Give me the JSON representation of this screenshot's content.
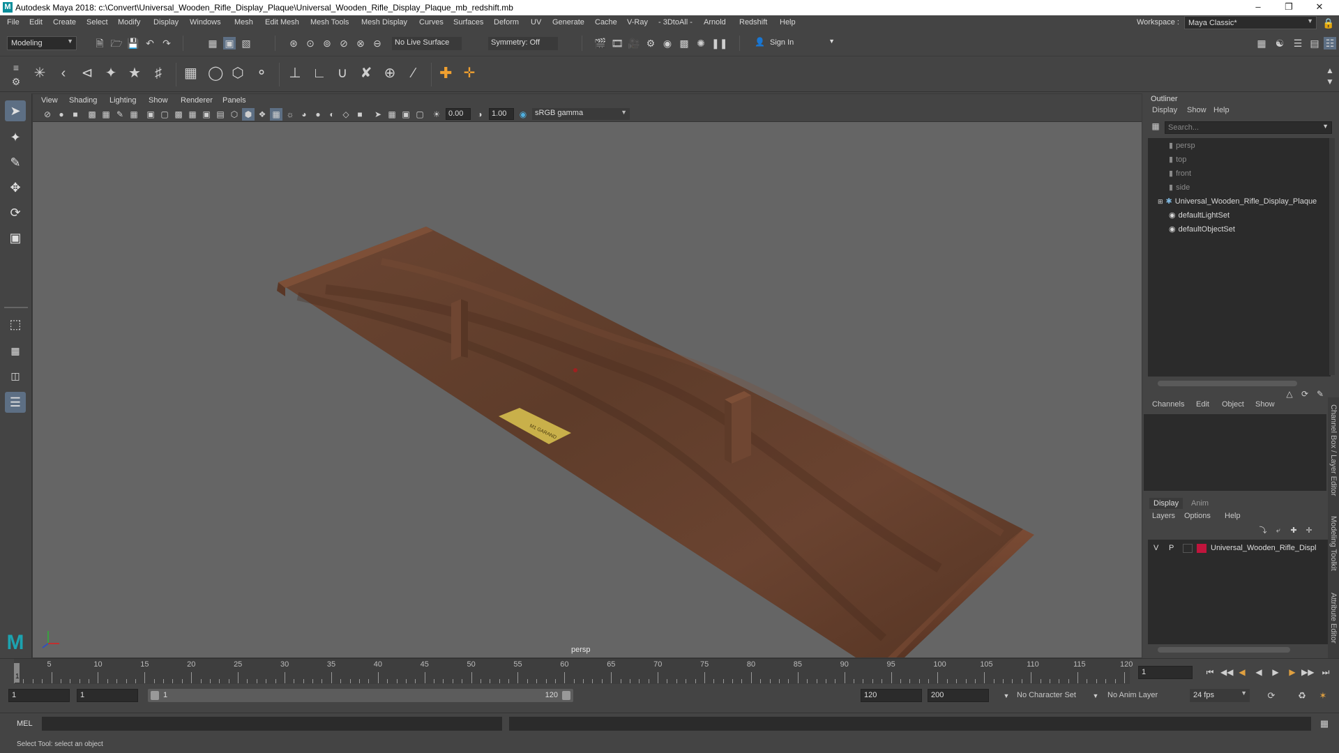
{
  "window": {
    "title": "Autodesk Maya 2018: c:\\Convert\\Universal_Wooden_Rifle_Display_Plaque\\Universal_Wooden_Rifle_Display_Plaque_mb_redshift.mb",
    "minimize_icon": "minimize-icon",
    "maximize_icon": "restore-icon",
    "close_icon": "close-icon"
  },
  "menubar": {
    "items": [
      "File",
      "Edit",
      "Create",
      "Select",
      "Modify",
      "Display",
      "Windows",
      "Mesh",
      "Edit Mesh",
      "Mesh Tools",
      "Mesh Display",
      "Curves",
      "Surfaces",
      "Deform",
      "UV",
      "Generate",
      "Cache",
      "V-Ray",
      "- 3DtoAll -",
      "Arnold",
      "Redshift",
      "Help"
    ],
    "workspace_label": "Workspace :",
    "workspace_value": "Maya Classic*"
  },
  "statusline": {
    "mode": "Modeling",
    "live_surface": "No Live Surface",
    "symmetry": "Symmetry: Off",
    "sign_in": "Sign In"
  },
  "viewport": {
    "menu": [
      "View",
      "Shading",
      "Lighting",
      "Show",
      "Renderer",
      "Panels"
    ],
    "exposure": "0.00",
    "gamma": "1.00",
    "color_space": "sRGB gamma",
    "camera_label": "persp",
    "plaque_text": "M1 GARAND"
  },
  "outliner": {
    "title": "Outliner",
    "menu": [
      "Display",
      "Show",
      "Help"
    ],
    "search_placeholder": "Search...",
    "items": [
      "persp",
      "top",
      "front",
      "side",
      "Universal_Wooden_Rifle_Display_Plaque",
      "defaultLightSet",
      "defaultObjectSet"
    ]
  },
  "channelbox": {
    "menu": [
      "Channels",
      "Edit",
      "Object",
      "Show"
    ]
  },
  "layers": {
    "tabs": [
      "Display",
      "Anim"
    ],
    "menu": [
      "Layers",
      "Options",
      "Help"
    ],
    "row": {
      "v": "V",
      "p": "P",
      "name": "Universal_Wooden_Rifle_Displ",
      "color": "#c0143c"
    }
  },
  "side_tabs": [
    "Channel Box / Layer Editor",
    "Modeling Toolkit",
    "Attribute Editor"
  ],
  "timeline": {
    "ticks": [
      "5",
      "10",
      "15",
      "20",
      "25",
      "30",
      "35",
      "40",
      "45",
      "50",
      "55",
      "60",
      "65",
      "70",
      "75",
      "80",
      "85",
      "90",
      "95",
      "100",
      "105",
      "110",
      "115",
      "120"
    ],
    "current_marker": "1",
    "current_frame": "1"
  },
  "range": {
    "start": "1",
    "anim_start": "1",
    "slider_start": "1",
    "slider_end": "120",
    "end": "120",
    "anim_end": "200",
    "character_set": "No Character Set",
    "anim_layer": "No Anim Layer",
    "fps": "24 fps"
  },
  "cmd": {
    "label": "MEL"
  },
  "help_line": "Select Tool: select an object"
}
